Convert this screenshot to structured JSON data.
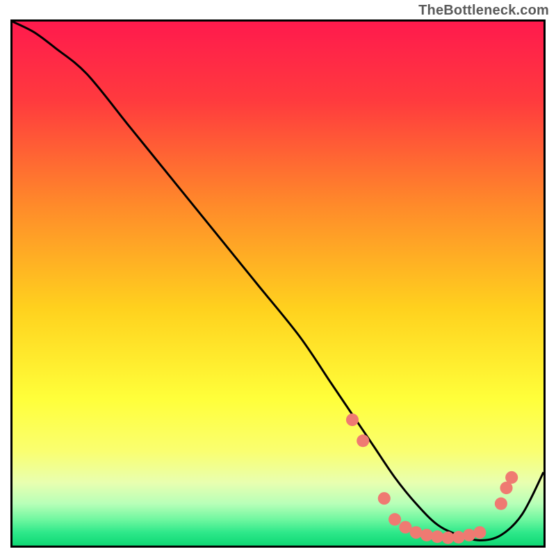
{
  "attribution": "TheBottleneck.com",
  "chart_data": {
    "type": "line",
    "title": "",
    "xlabel": "",
    "ylabel": "",
    "xlim": [
      0,
      100
    ],
    "ylim": [
      0,
      100
    ],
    "background_gradient": {
      "stops": [
        {
          "offset": 0.0,
          "color": "#ff1a4d"
        },
        {
          "offset": 0.15,
          "color": "#ff3a3e"
        },
        {
          "offset": 0.35,
          "color": "#ff8a2a"
        },
        {
          "offset": 0.55,
          "color": "#ffd21e"
        },
        {
          "offset": 0.72,
          "color": "#ffff3a"
        },
        {
          "offset": 0.82,
          "color": "#faff70"
        },
        {
          "offset": 0.88,
          "color": "#e8ffb0"
        },
        {
          "offset": 0.92,
          "color": "#b8ffb8"
        },
        {
          "offset": 0.95,
          "color": "#70f7a0"
        },
        {
          "offset": 0.975,
          "color": "#2ee88a"
        },
        {
          "offset": 1.0,
          "color": "#0fd874"
        }
      ]
    },
    "series": [
      {
        "name": "bottleneck-curve",
        "x": [
          0,
          4,
          8,
          14,
          22,
          30,
          38,
          46,
          54,
          60,
          64,
          68,
          72,
          76,
          80,
          84,
          88,
          92,
          96,
          100
        ],
        "y": [
          100,
          98,
          95,
          90,
          80,
          70,
          60,
          50,
          40,
          31,
          25,
          19,
          13,
          8,
          4,
          2,
          1,
          2,
          6,
          14
        ]
      }
    ],
    "markers": {
      "name": "bead-markers",
      "color": "#ef7a72",
      "radius": 9,
      "points": [
        {
          "x": 64,
          "y": 24
        },
        {
          "x": 66,
          "y": 20
        },
        {
          "x": 70,
          "y": 9
        },
        {
          "x": 72,
          "y": 5
        },
        {
          "x": 74,
          "y": 3.5
        },
        {
          "x": 76,
          "y": 2.5
        },
        {
          "x": 78,
          "y": 2
        },
        {
          "x": 80,
          "y": 1.7
        },
        {
          "x": 82,
          "y": 1.5
        },
        {
          "x": 84,
          "y": 1.6
        },
        {
          "x": 86,
          "y": 2
        },
        {
          "x": 88,
          "y": 2.5
        },
        {
          "x": 92,
          "y": 8
        },
        {
          "x": 93,
          "y": 11
        },
        {
          "x": 94,
          "y": 13
        }
      ]
    }
  }
}
